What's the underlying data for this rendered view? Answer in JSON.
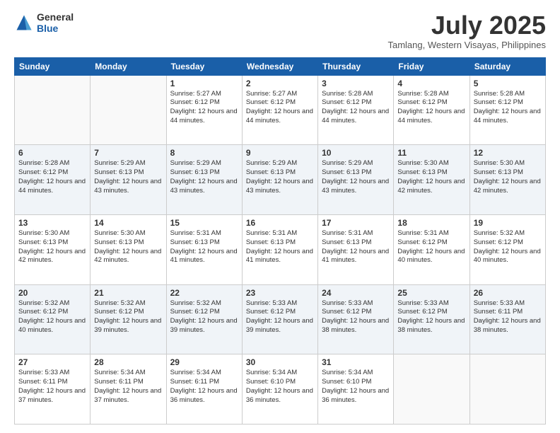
{
  "logo": {
    "general": "General",
    "blue": "Blue"
  },
  "header": {
    "month": "July 2025",
    "location": "Tamlang, Western Visayas, Philippines"
  },
  "weekdays": [
    "Sunday",
    "Monday",
    "Tuesday",
    "Wednesday",
    "Thursday",
    "Friday",
    "Saturday"
  ],
  "weeks": [
    [
      {
        "day": "",
        "info": ""
      },
      {
        "day": "",
        "info": ""
      },
      {
        "day": "1",
        "info": "Sunrise: 5:27 AM\nSunset: 6:12 PM\nDaylight: 12 hours and 44 minutes."
      },
      {
        "day": "2",
        "info": "Sunrise: 5:27 AM\nSunset: 6:12 PM\nDaylight: 12 hours and 44 minutes."
      },
      {
        "day": "3",
        "info": "Sunrise: 5:28 AM\nSunset: 6:12 PM\nDaylight: 12 hours and 44 minutes."
      },
      {
        "day": "4",
        "info": "Sunrise: 5:28 AM\nSunset: 6:12 PM\nDaylight: 12 hours and 44 minutes."
      },
      {
        "day": "5",
        "info": "Sunrise: 5:28 AM\nSunset: 6:12 PM\nDaylight: 12 hours and 44 minutes."
      }
    ],
    [
      {
        "day": "6",
        "info": "Sunrise: 5:28 AM\nSunset: 6:12 PM\nDaylight: 12 hours and 44 minutes."
      },
      {
        "day": "7",
        "info": "Sunrise: 5:29 AM\nSunset: 6:13 PM\nDaylight: 12 hours and 43 minutes."
      },
      {
        "day": "8",
        "info": "Sunrise: 5:29 AM\nSunset: 6:13 PM\nDaylight: 12 hours and 43 minutes."
      },
      {
        "day": "9",
        "info": "Sunrise: 5:29 AM\nSunset: 6:13 PM\nDaylight: 12 hours and 43 minutes."
      },
      {
        "day": "10",
        "info": "Sunrise: 5:29 AM\nSunset: 6:13 PM\nDaylight: 12 hours and 43 minutes."
      },
      {
        "day": "11",
        "info": "Sunrise: 5:30 AM\nSunset: 6:13 PM\nDaylight: 12 hours and 42 minutes."
      },
      {
        "day": "12",
        "info": "Sunrise: 5:30 AM\nSunset: 6:13 PM\nDaylight: 12 hours and 42 minutes."
      }
    ],
    [
      {
        "day": "13",
        "info": "Sunrise: 5:30 AM\nSunset: 6:13 PM\nDaylight: 12 hours and 42 minutes."
      },
      {
        "day": "14",
        "info": "Sunrise: 5:30 AM\nSunset: 6:13 PM\nDaylight: 12 hours and 42 minutes."
      },
      {
        "day": "15",
        "info": "Sunrise: 5:31 AM\nSunset: 6:13 PM\nDaylight: 12 hours and 41 minutes."
      },
      {
        "day": "16",
        "info": "Sunrise: 5:31 AM\nSunset: 6:13 PM\nDaylight: 12 hours and 41 minutes."
      },
      {
        "day": "17",
        "info": "Sunrise: 5:31 AM\nSunset: 6:13 PM\nDaylight: 12 hours and 41 minutes."
      },
      {
        "day": "18",
        "info": "Sunrise: 5:31 AM\nSunset: 6:12 PM\nDaylight: 12 hours and 40 minutes."
      },
      {
        "day": "19",
        "info": "Sunrise: 5:32 AM\nSunset: 6:12 PM\nDaylight: 12 hours and 40 minutes."
      }
    ],
    [
      {
        "day": "20",
        "info": "Sunrise: 5:32 AM\nSunset: 6:12 PM\nDaylight: 12 hours and 40 minutes."
      },
      {
        "day": "21",
        "info": "Sunrise: 5:32 AM\nSunset: 6:12 PM\nDaylight: 12 hours and 39 minutes."
      },
      {
        "day": "22",
        "info": "Sunrise: 5:32 AM\nSunset: 6:12 PM\nDaylight: 12 hours and 39 minutes."
      },
      {
        "day": "23",
        "info": "Sunrise: 5:33 AM\nSunset: 6:12 PM\nDaylight: 12 hours and 39 minutes."
      },
      {
        "day": "24",
        "info": "Sunrise: 5:33 AM\nSunset: 6:12 PM\nDaylight: 12 hours and 38 minutes."
      },
      {
        "day": "25",
        "info": "Sunrise: 5:33 AM\nSunset: 6:12 PM\nDaylight: 12 hours and 38 minutes."
      },
      {
        "day": "26",
        "info": "Sunrise: 5:33 AM\nSunset: 6:11 PM\nDaylight: 12 hours and 38 minutes."
      }
    ],
    [
      {
        "day": "27",
        "info": "Sunrise: 5:33 AM\nSunset: 6:11 PM\nDaylight: 12 hours and 37 minutes."
      },
      {
        "day": "28",
        "info": "Sunrise: 5:34 AM\nSunset: 6:11 PM\nDaylight: 12 hours and 37 minutes."
      },
      {
        "day": "29",
        "info": "Sunrise: 5:34 AM\nSunset: 6:11 PM\nDaylight: 12 hours and 36 minutes."
      },
      {
        "day": "30",
        "info": "Sunrise: 5:34 AM\nSunset: 6:10 PM\nDaylight: 12 hours and 36 minutes."
      },
      {
        "day": "31",
        "info": "Sunrise: 5:34 AM\nSunset: 6:10 PM\nDaylight: 12 hours and 36 minutes."
      },
      {
        "day": "",
        "info": ""
      },
      {
        "day": "",
        "info": ""
      }
    ]
  ]
}
